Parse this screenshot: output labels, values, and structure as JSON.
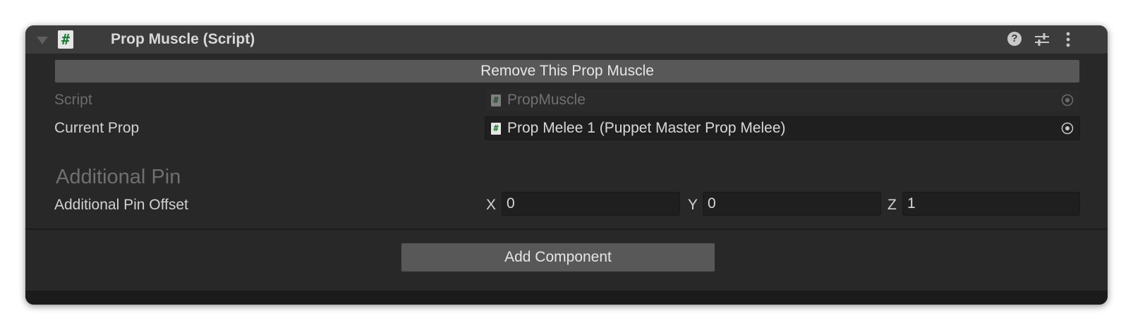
{
  "component": {
    "title": "Prop Muscle (Script)",
    "header_icon": "csharp-script-icon",
    "help_icon": "help-icon",
    "presets_icon": "presets-icon",
    "menu_icon": "kebab-menu-icon"
  },
  "remove_button": {
    "label": "Remove This Prop Muscle"
  },
  "fields": {
    "script": {
      "label": "Script",
      "value": "PropMuscle"
    },
    "current_prop": {
      "label": "Current Prop",
      "value": "Prop Melee 1 (Puppet Master Prop Melee)"
    }
  },
  "additional_pin": {
    "heading": "Additional Pin",
    "offset": {
      "label": "Additional Pin Offset",
      "x_label": "X",
      "x": "0",
      "y_label": "Y",
      "y": "0",
      "z_label": "Z",
      "z": "1"
    }
  },
  "add_component": {
    "label": "Add Component"
  },
  "colors": {
    "panel": "#282828",
    "header": "#3c3c3c",
    "button": "#585858",
    "field": "#1f1f1f",
    "text": "#d8d8d8",
    "disabled_text": "#707070"
  }
}
